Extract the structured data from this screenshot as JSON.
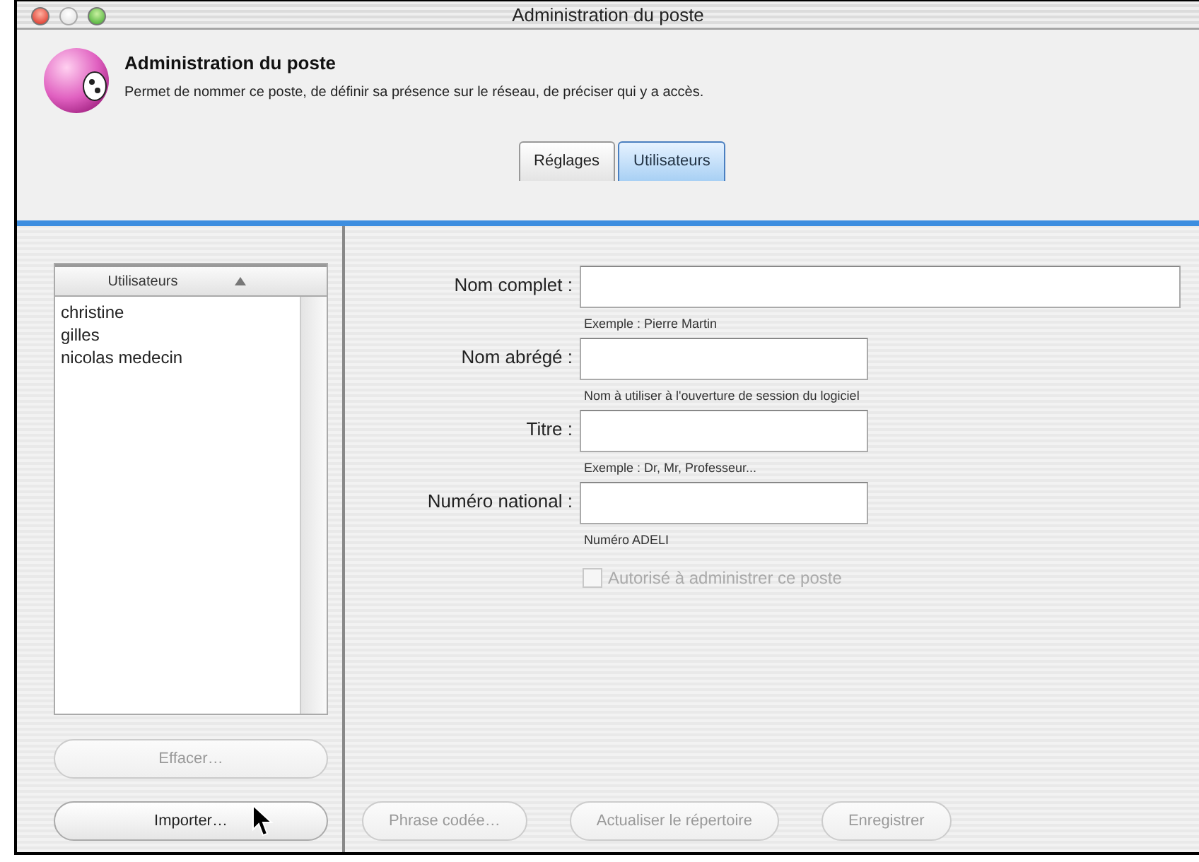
{
  "window": {
    "title": "Administration du poste"
  },
  "header": {
    "title": "Administration du poste",
    "description": "Permet de nommer ce poste, de définir sa présence sur le réseau, de préciser qui y a accès."
  },
  "tabs": [
    {
      "label": "Réglages",
      "selected": false
    },
    {
      "label": "Utilisateurs",
      "selected": true
    }
  ],
  "users_list": {
    "column_header": "Utilisateurs",
    "items": [
      {
        "name": "christine"
      },
      {
        "name": "gilles"
      },
      {
        "name": "nicolas medecin"
      }
    ]
  },
  "list_buttons": [
    {
      "label": "Effacer…",
      "disabled": true
    },
    {
      "label": "Importer…",
      "disabled": false
    }
  ],
  "form": {
    "fields": [
      {
        "label": "Nom complet :",
        "hint": "Exemple : Pierre Martin",
        "kind": "long"
      },
      {
        "label": "Nom abrégé :",
        "hint": "Nom à utiliser à l'ouverture de session du logiciel",
        "kind": "short"
      },
      {
        "label": "Titre :",
        "hint": "Exemple : Dr, Mr, Professeur...",
        "kind": "short"
      },
      {
        "label": "Numéro national :",
        "hint": "Numéro ADELI",
        "kind": "short"
      }
    ],
    "checkbox": {
      "label": "Autorisé à administrer ce poste",
      "checked": false,
      "disabled": true
    }
  },
  "form_buttons": [
    {
      "label": "Phrase codée…",
      "disabled": true
    },
    {
      "label": "Actualiser le répertoire",
      "disabled": true
    },
    {
      "label": "Enregistrer",
      "disabled": true
    }
  ]
}
